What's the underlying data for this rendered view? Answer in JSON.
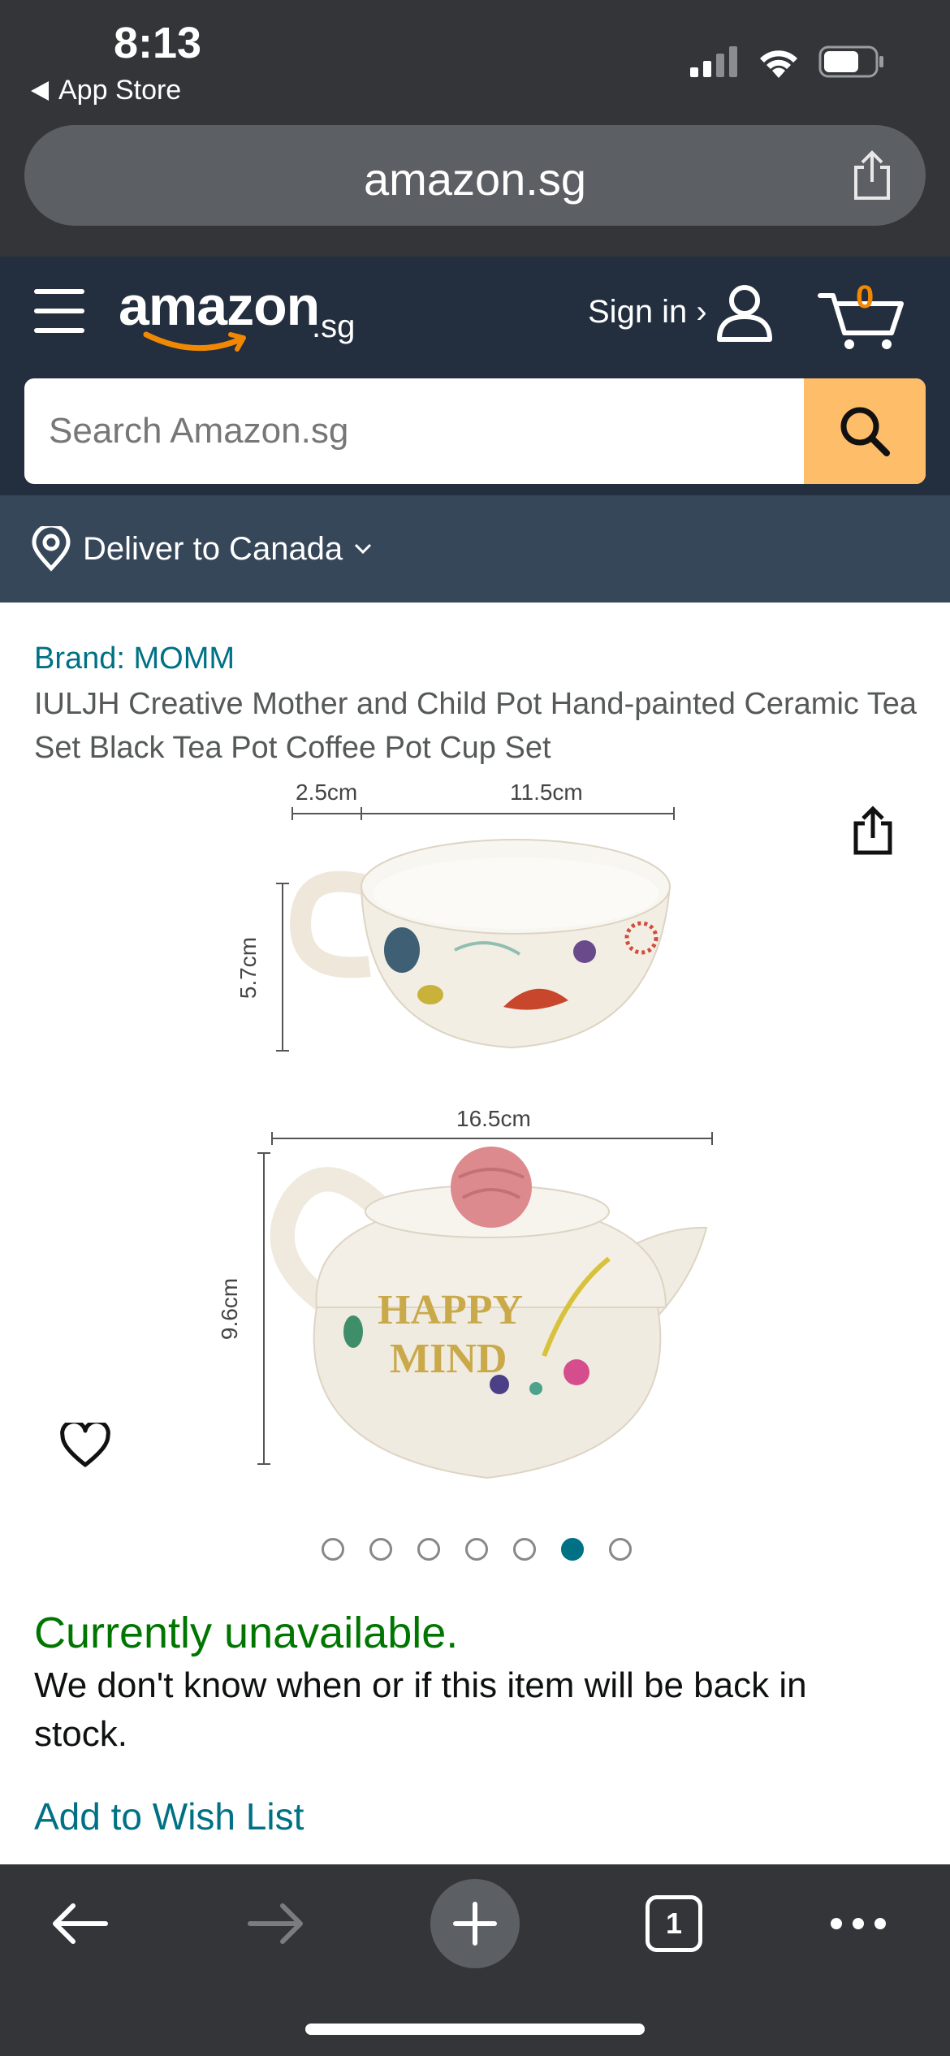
{
  "status_bar": {
    "time": "8:13",
    "back_app": "App Store"
  },
  "browser": {
    "url": "amazon.sg"
  },
  "header": {
    "logo_word": "amazon",
    "logo_suffix": ".sg",
    "signin_label": "Sign in ›",
    "cart_count": "0",
    "search_placeholder": "Search Amazon.sg"
  },
  "delivery": {
    "label": "Deliver to Canada"
  },
  "product": {
    "brand": "Brand: MOMM",
    "title": "IULJH Creative Mother and Child Pot Hand-painted Ceramic Tea Set Black Tea Pot Coffee Pot Cup Set",
    "image_dims": {
      "cup_handle": "2.5cm",
      "cup_width": "11.5cm",
      "cup_height": "5.7cm",
      "pot_width": "16.5cm",
      "pot_height": "9.6cm"
    },
    "pot_text_line1": "HAPPY",
    "pot_text_line2": "MIND",
    "image_count": 7,
    "active_image_index": 5
  },
  "availability": {
    "status": "Currently unavailable.",
    "note": "We don't know when or if this item will be back in stock."
  },
  "actions": {
    "wishlist": "Add to Wish List"
  },
  "toolbar": {
    "tab_count": "1"
  },
  "colors": {
    "chrome": "#333538",
    "amazon_header": "#232f3e",
    "deliver_bar": "#37475a",
    "link": "#007185",
    "unavailable": "#007600",
    "search_button": "#febd69",
    "cart_count": "#f08804"
  }
}
